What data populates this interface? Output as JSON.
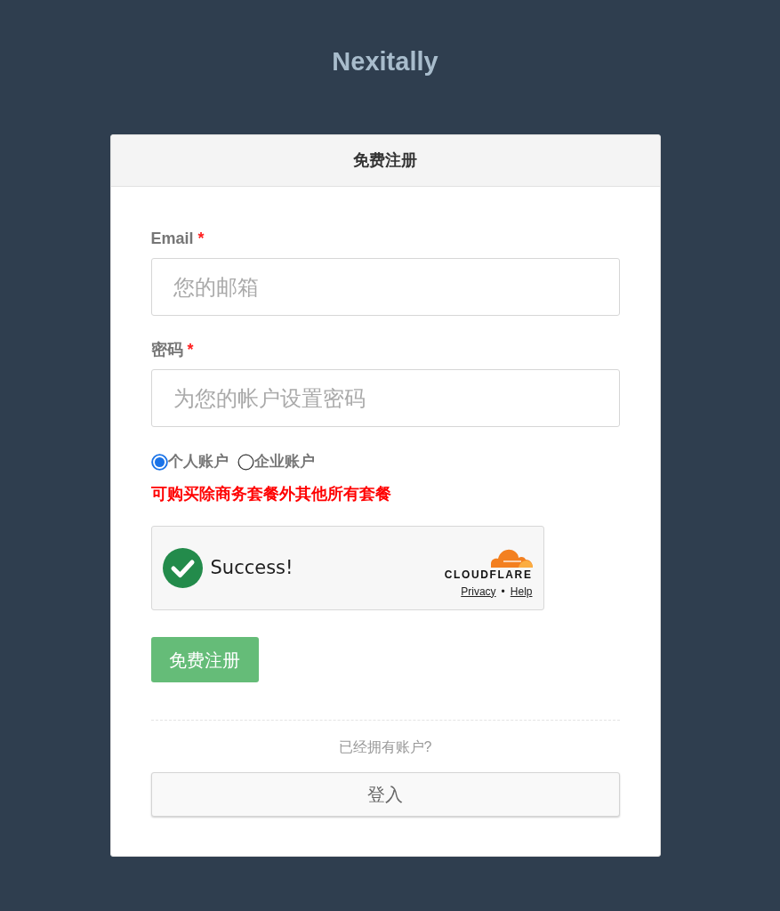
{
  "site": {
    "title": "Nexitally"
  },
  "card": {
    "title": "免费注册"
  },
  "fields": [
    {
      "label": "Email",
      "required_mark": "*",
      "placeholder": "您的邮箱"
    },
    {
      "label": "密码",
      "required_mark": "*",
      "placeholder": "为您的帐户设置密码"
    }
  ],
  "account_types": [
    {
      "label": "个人账户",
      "selected": true
    },
    {
      "label": "企业账户",
      "selected": false
    }
  ],
  "notice": "可购买除商务套餐外其他所有套餐",
  "captcha": {
    "status": "Success!",
    "brand": "CLOUDFLARE",
    "links": [
      "Privacy",
      "Help"
    ],
    "separator": "•"
  },
  "submit_button": "免费注册",
  "login_prompt": "已经拥有账户?",
  "login_button": "登入"
}
